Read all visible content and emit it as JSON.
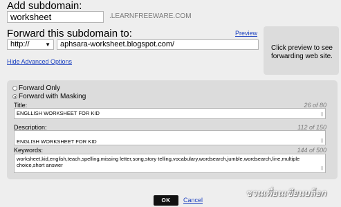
{
  "header": {
    "title": "Add subdomain:",
    "subdomain_value": "worksheet",
    "domain_suffix": ".LEARNFREEWARE.COM"
  },
  "forward": {
    "title": "Forward this subdomain to:",
    "preview_link": "Preview",
    "protocol_value": "http://",
    "url_value": "aphsara-worksheet.blogspot.com/",
    "preview_hint": "Click preview to see forwarding web site.",
    "advanced_link": "Hide Advanced Options"
  },
  "options": {
    "forward_only_label": "Forward Only",
    "forward_masking_label": "Forward with Masking",
    "selected": "Forward with Masking"
  },
  "fields": {
    "title_label": "Title:",
    "title_count": "26 of 80",
    "title_value": "ENGLLISH WORKSHEET FOR KID",
    "description_label": "Description:",
    "description_count": "112 of 150",
    "description_value": "ENGLISH WORKSHEET FOR KID\nEasy english worksheet for kid ,crossword,spelling,missing letter,song,story telling",
    "keywords_label": "Keywords:",
    "keywords_count": "144 of 500",
    "keywords_value": "worksheet,kid,english,teach,spelling,missing letter,song,story telling,vocabulary,wordsearch,jumble,wordsearch,line,multiple choice,short answer"
  },
  "actions": {
    "ok_label": "OK",
    "cancel_label": "Cancel"
  },
  "watermark": "ชวนเพื่อนเขียนบล็อก"
}
